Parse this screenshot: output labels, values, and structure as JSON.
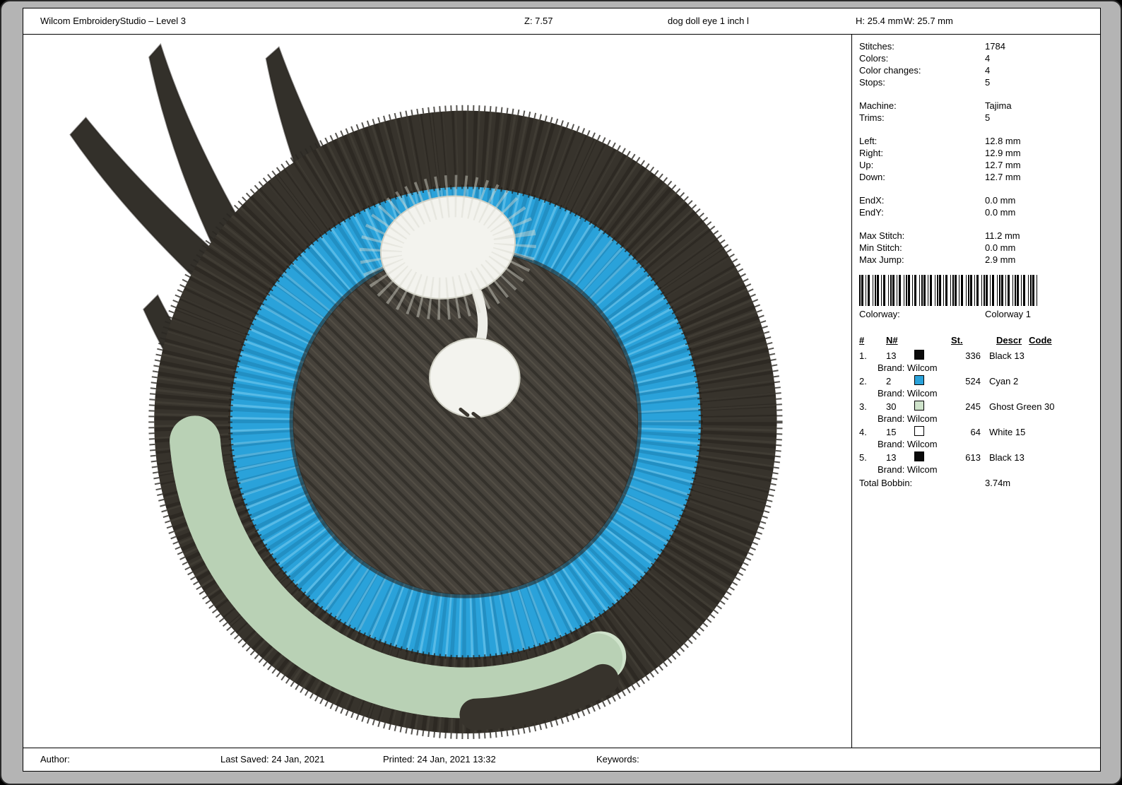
{
  "header": {
    "app_title": "Wilcom EmbroideryStudio – Level 3",
    "zoom": "Z: 7.57",
    "design_name": "dog doll eye 1 inch l",
    "height": "H: 25.4 mm",
    "width": "W: 25.7 mm"
  },
  "stats": {
    "groups": [
      {
        "items": [
          {
            "label": "Stitches:",
            "value": "1784"
          },
          {
            "label": "Colors:",
            "value": "4"
          },
          {
            "label": "Color changes:",
            "value": "4"
          },
          {
            "label": "Stops:",
            "value": "5"
          }
        ]
      },
      {
        "items": [
          {
            "label": "Machine:",
            "value": "Tajima"
          },
          {
            "label": "Trims:",
            "value": "5"
          }
        ]
      },
      {
        "items": [
          {
            "label": "Left:",
            "value": "12.8 mm"
          },
          {
            "label": "Right:",
            "value": "12.9 mm"
          },
          {
            "label": "Up:",
            "value": "12.7 mm"
          },
          {
            "label": "Down:",
            "value": "12.7 mm"
          }
        ]
      },
      {
        "items": [
          {
            "label": "EndX:",
            "value": "0.0 mm"
          },
          {
            "label": "EndY:",
            "value": "0.0 mm"
          }
        ]
      },
      {
        "items": [
          {
            "label": "Max Stitch:",
            "value": "11.2 mm"
          },
          {
            "label": "Min Stitch:",
            "value": "0.0 mm"
          },
          {
            "label": "Max Jump:",
            "value": "2.9 mm"
          }
        ]
      }
    ]
  },
  "colorway": {
    "label": "Colorway:",
    "value": "Colorway 1"
  },
  "thread_table": {
    "headers": {
      "num": "#",
      "n": "N#",
      "st": "St.",
      "descr": "Descr",
      "code": "Code"
    },
    "rows": [
      {
        "num": "1.",
        "n": "13",
        "swatch": "#0a0a0a",
        "st": "336",
        "descr": "Black 13",
        "brand": "Brand: Wilcom"
      },
      {
        "num": "2.",
        "n": "2",
        "swatch": "#2aa2da",
        "st": "524",
        "descr": "Cyan 2",
        "brand": "Brand: Wilcom"
      },
      {
        "num": "3.",
        "n": "30",
        "swatch": "#cfe3cb",
        "st": "245",
        "descr": "Ghost Green 30",
        "brand": "Brand: Wilcom"
      },
      {
        "num": "4.",
        "n": "15",
        "swatch": "#ffffff",
        "st": "64",
        "descr": "White 15",
        "brand": "Brand: Wilcom"
      },
      {
        "num": "5.",
        "n": "13",
        "swatch": "#0a0a0a",
        "st": "613",
        "descr": "Black 13",
        "brand": "Brand: Wilcom"
      }
    ],
    "total_label": "Total Bobbin:",
    "total_value": "3.74m"
  },
  "footer": {
    "author": "Author:",
    "last_saved": "Last Saved: 24 Jan, 2021",
    "printed": "Printed: 24 Jan, 2021 13:32",
    "keywords": "Keywords:"
  },
  "design": {
    "colors": {
      "outer_ring": "#37332c",
      "iris_cyan": "#2aa2da",
      "ghost_green": "#cfe3cb",
      "pupil": "#46423b",
      "highlight_white": "#f3f3ee",
      "lash": "#33302a"
    }
  }
}
